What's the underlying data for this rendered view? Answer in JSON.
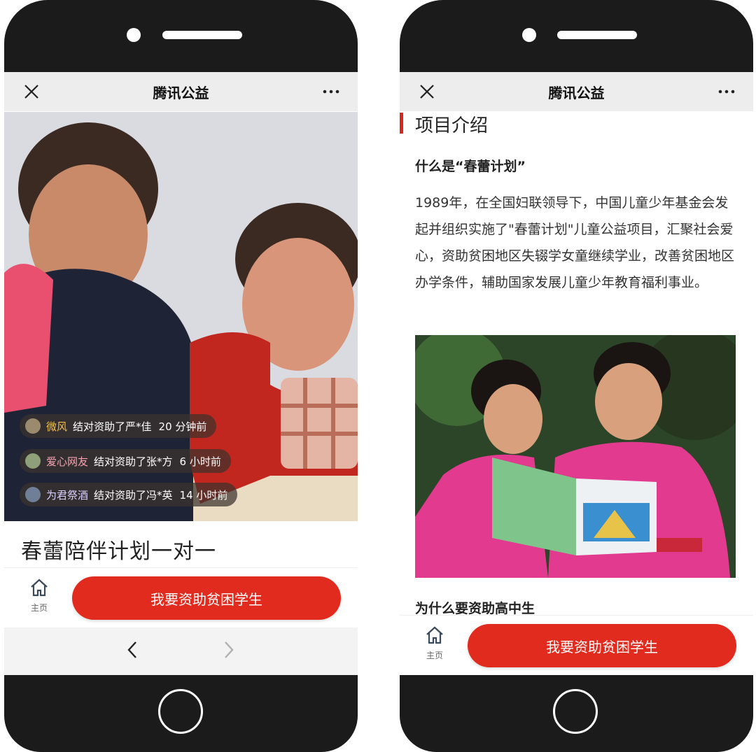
{
  "left": {
    "app_title": "腾讯公益",
    "donations": [
      {
        "name": "微风",
        "action": "结对资助了严*佳",
        "time": "20 分钟前"
      },
      {
        "name": "爱心网友",
        "action": "结对资助了张*方",
        "time": "6 小时前"
      },
      {
        "name": "为君祭酒",
        "action": "结对资助了冯*英",
        "time": "14 小时前"
      }
    ],
    "campaign_title": "春蕾陪伴计划一对一",
    "home_label": "主页",
    "cta_label": "我要资助贫困学生"
  },
  "right": {
    "app_title": "腾讯公益",
    "section_title": "项目介绍",
    "question1": "什么是“春蕾计划”",
    "intro_text": "1989年，在全国妇联领导下，中国儿童少年基金会发起并组织实施了\"春蕾计划\"儿童公益项目，汇聚社会爱心，资助贫困地区失辍学女童继续学业，改善贫困地区办学条件，辅助国家发展儿童少年教育福利事业。",
    "question2": "为什么要资助高中生",
    "home_label": "主页",
    "cta_label": "我要资助贫困学生"
  },
  "colors": {
    "accent": "#e12b1e",
    "section_bar": "#d6291c"
  },
  "icons": [
    "close-icon",
    "more-icon",
    "home-icon",
    "back-arrow-icon",
    "forward-arrow-icon"
  ]
}
